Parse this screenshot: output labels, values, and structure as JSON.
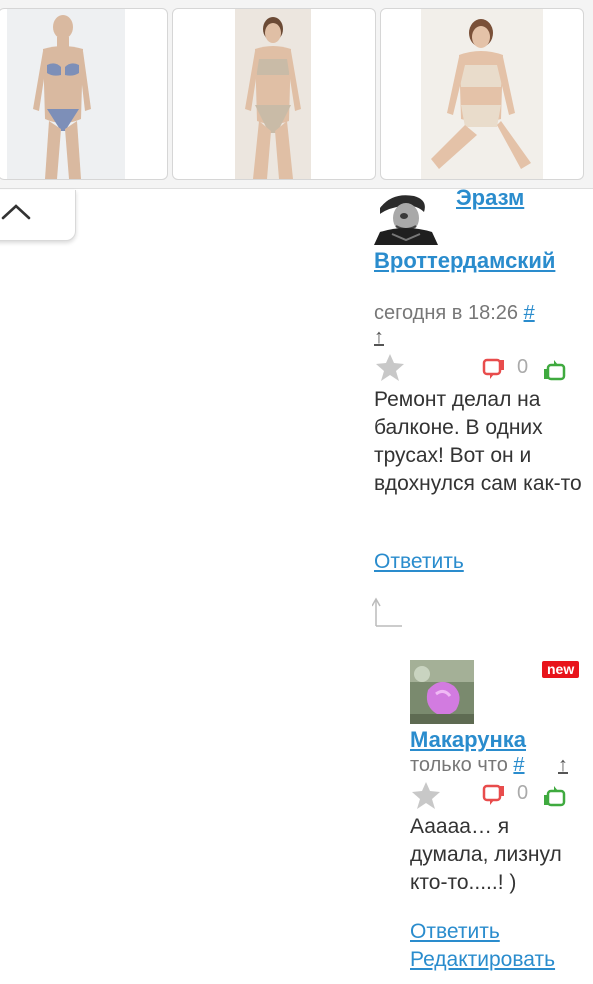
{
  "carousel": {
    "items": [
      {
        "name": "product-1",
        "icon": "swimsuit-photo-blue"
      },
      {
        "name": "product-2",
        "icon": "swimsuit-photo-beige"
      },
      {
        "name": "product-3",
        "icon": "swimsuit-photo-cream"
      }
    ]
  },
  "collapse": {
    "icon": "chevron-up-icon"
  },
  "comments": [
    {
      "author_line1": "Эразм",
      "author_line2": "Вроттердамский",
      "time": "сегодня в 18:26",
      "anchor": "#",
      "parent_arrow": "↑",
      "rating": "0",
      "text": "Ремонт делал на балконе. В одних трусах! Вот он и вдохнулся сам как-то",
      "reply": "Ответить"
    },
    {
      "badge": "new",
      "author": "Макарунка",
      "time": "только что",
      "anchor": "#",
      "parent_arrow": "↑",
      "rating": "0",
      "text": "Ааааа… я думала, лизнул кто-то.....! )",
      "reply": "Ответить",
      "edit": "Редактировать"
    }
  ],
  "colors": {
    "link": "#2a8ccd",
    "badge": "#e8141b",
    "dislike": "#e84c4c",
    "like": "#3faa3f",
    "star": "#c8c8c8"
  }
}
